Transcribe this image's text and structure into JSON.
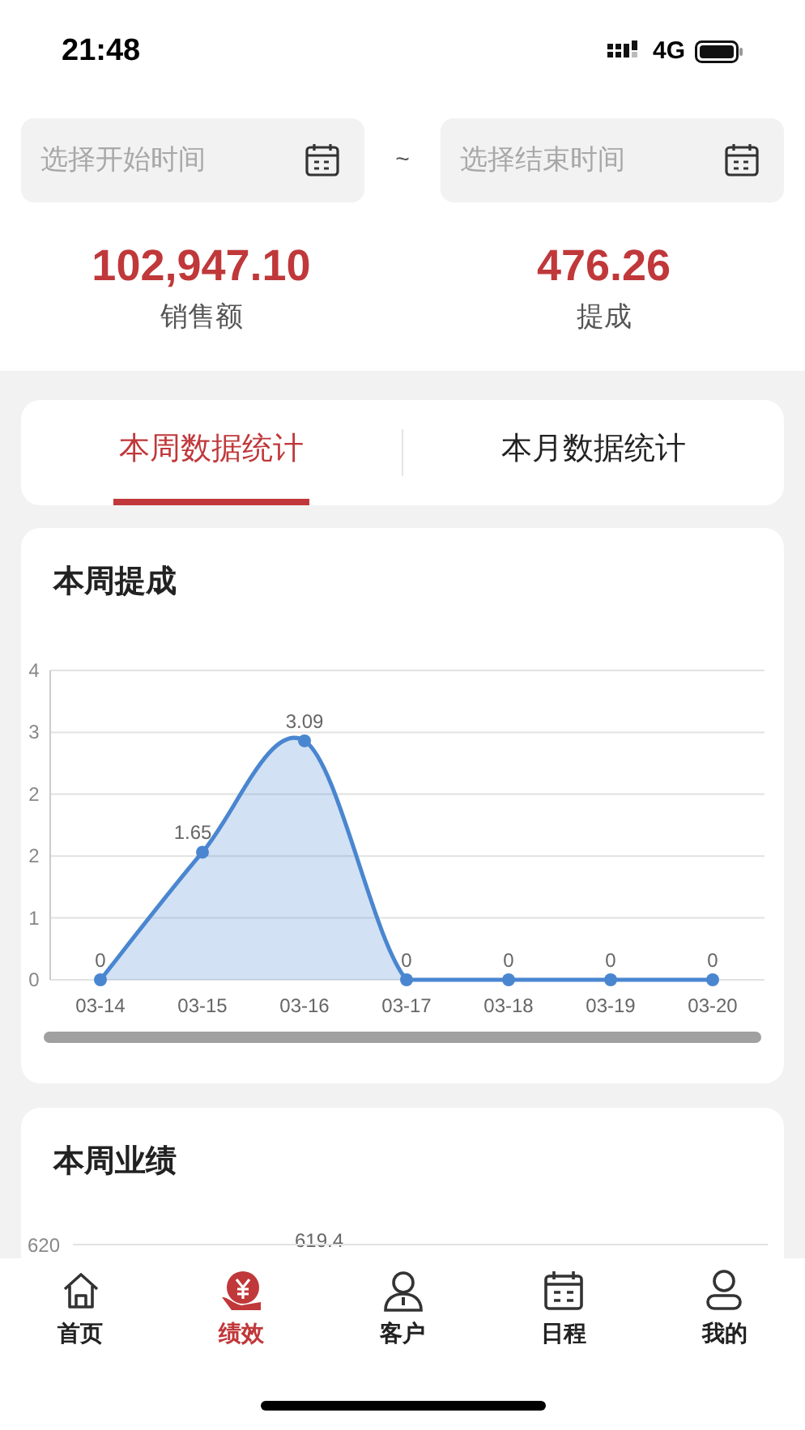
{
  "status_bar": {
    "time": "21:48",
    "network": "4G"
  },
  "date_range": {
    "start": {
      "placeholder": "选择开始时间"
    },
    "separator": "~",
    "end": {
      "placeholder": "选择结束时间"
    }
  },
  "summary": [
    {
      "value": "102,947.10",
      "label": "销售额"
    },
    {
      "value": "476.26",
      "label": "提成"
    }
  ],
  "tabs": [
    {
      "label": "本周数据统计",
      "selected": true
    },
    {
      "label": "本月数据统计",
      "selected": false
    }
  ],
  "commission_card": {
    "title": "本周提成",
    "chart_data": {
      "type": "area",
      "categories": [
        "03-14",
        "03-15",
        "03-16",
        "03-17",
        "03-18",
        "03-19",
        "03-20"
      ],
      "series": [
        {
          "color": "#4a86d0",
          "values": [
            0,
            1.65,
            3.09,
            0,
            0,
            0,
            0
          ]
        }
      ],
      "grid": true,
      "ylim": [
        0,
        4
      ],
      "yticks": [
        {
          "value": 0,
          "label": "0"
        },
        {
          "value": 0.8,
          "label": "1"
        },
        {
          "value": 1.6,
          "label": "2"
        },
        {
          "value": 2.4,
          "label": "2"
        },
        {
          "value": 3.2,
          "label": "3"
        },
        {
          "value": 4,
          "label": "4"
        }
      ],
      "data_labels": true
    }
  },
  "performance_card": {
    "title": "本周业绩",
    "axis_label": "620",
    "value_label": "619.4"
  },
  "tab_bar": [
    {
      "label": "首页",
      "kind": "home",
      "selected": false
    },
    {
      "label": "绩效",
      "kind": "performance",
      "selected": true
    },
    {
      "label": "客户",
      "kind": "customer",
      "selected": false
    },
    {
      "label": "日程",
      "kind": "schedule",
      "selected": false
    },
    {
      "label": "我的",
      "kind": "me",
      "selected": false
    }
  ]
}
